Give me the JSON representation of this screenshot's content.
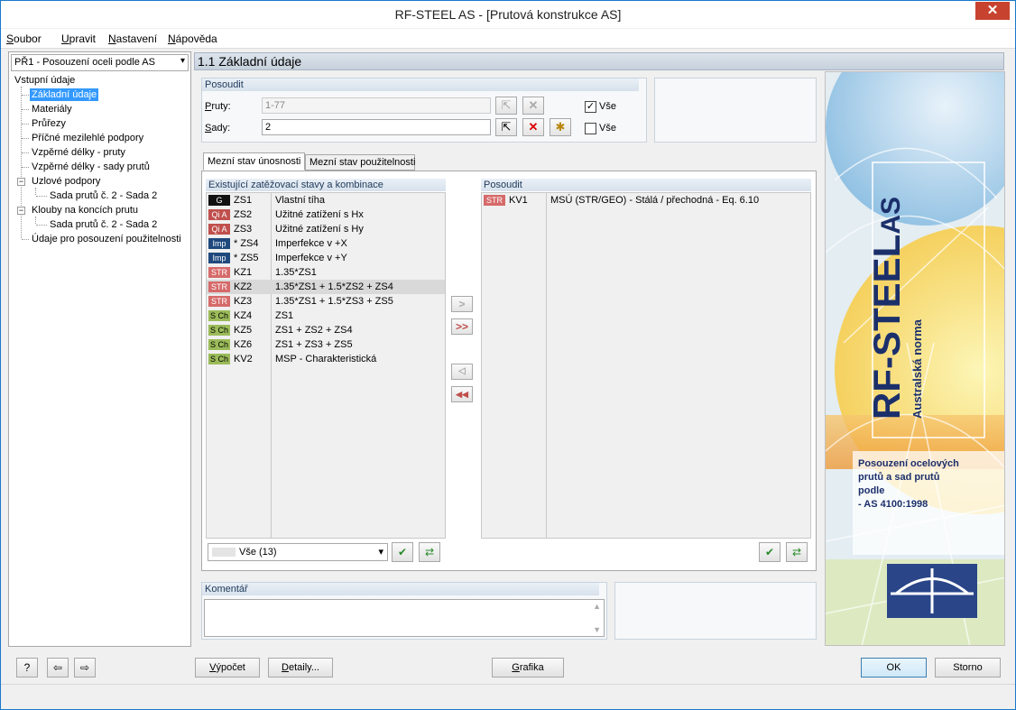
{
  "window": {
    "title": "RF-STEEL AS - [Prutová konstrukce AS]",
    "close_glyph": "✕"
  },
  "menu": [
    {
      "first": "S",
      "rest": "oubor"
    },
    {
      "first": "U",
      "rest": "pravit"
    },
    {
      "first": "N",
      "rest": "astavení"
    },
    {
      "first": "N",
      "rest": "ápověda"
    }
  ],
  "case_select": {
    "value": "PŘ1 - Posouzení oceli podle AS",
    "arrow": "▾"
  },
  "tree": {
    "root": "Vstupní údaje",
    "items": [
      "Základní údaje",
      "Materiály",
      "Průřezy",
      "Příčné mezilehlé podpory",
      "Vzpěrné délky - pruty",
      "Vzpěrné délky - sady prutů",
      "Uzlové podpory",
      "Sada prutů č. 2 - Sada 2",
      "Klouby na koncích prutu",
      "Sada prutů č. 2 - Sada 2",
      "Údaje pro posouzení použitelnosti"
    ],
    "expander_glyph": "−"
  },
  "header": {
    "title": "1.1 Základní údaje"
  },
  "posoudit": {
    "title": "Posoudit",
    "pruty_label_first": "P",
    "pruty_label_rest": "ruty:",
    "pruty_value": "1-77",
    "sady_label_first": "S",
    "sady_label_rest": "ady:",
    "sady_value": "2",
    "vse1_label": "Vše",
    "vse1_checked": "✓",
    "vse2_label": "Vše",
    "vse2_checked": ""
  },
  "tabs": [
    {
      "label": "Mezní stav únosnosti",
      "active": true
    },
    {
      "label": "Mezní stav použitelnosti",
      "active": false
    }
  ],
  "existing": {
    "title": "Existující zatěžovací stavy a kombinace",
    "rows": [
      {
        "badge": "G",
        "type": "G",
        "code": "ZS1",
        "desc": "Vlastní tíha"
      },
      {
        "badge": "Qi A",
        "type": "QiA",
        "code": "ZS2",
        "desc": "Užitné zatížení s Hx"
      },
      {
        "badge": "Qi A",
        "type": "QiA",
        "code": "ZS3",
        "desc": "Užitné zatížení s Hy"
      },
      {
        "badge": "Imp",
        "type": "Imp",
        "code": "* ZS4",
        "desc": "Imperfekce v +X"
      },
      {
        "badge": "Imp",
        "type": "Imp",
        "code": "* ZS5",
        "desc": "Imperfekce v +Y"
      },
      {
        "badge": "STR",
        "type": "STR",
        "code": "KZ1",
        "desc": "1.35*ZS1"
      },
      {
        "badge": "STR",
        "type": "STR",
        "code": "KZ2",
        "desc": "1.35*ZS1 + 1.5*ZS2 + ZS4"
      },
      {
        "badge": "STR",
        "type": "STR",
        "code": "KZ3",
        "desc": "1.35*ZS1 + 1.5*ZS3 + ZS5"
      },
      {
        "badge": "S Ch",
        "type": "SCh",
        "code": "KZ4",
        "desc": "ZS1"
      },
      {
        "badge": "S Ch",
        "type": "SCh",
        "code": "KZ5",
        "desc": "ZS1 + ZS2 + ZS4"
      },
      {
        "badge": "S Ch",
        "type": "SCh",
        "code": "KZ6",
        "desc": "ZS1 + ZS3 + ZS5"
      },
      {
        "badge": "S Ch",
        "type": "SCh",
        "code": "KV2",
        "desc": "MSP - Charakteristická"
      }
    ],
    "filter_value": "Vše (13)"
  },
  "selected": {
    "title": "Posoudit",
    "rows": [
      {
        "badge": "STR",
        "type": "STR",
        "code": "KV1",
        "desc": "MSÚ (STR/GEO) - Stálá / přechodná - Eq. 6.10"
      }
    ]
  },
  "transfer": {
    "add": ">",
    "add_all": ">>",
    "remove": "◁",
    "remove_all": "◀◀"
  },
  "comment": {
    "title": "Komentář"
  },
  "art": {
    "product": "RF-STEEL",
    "suffix": "AS",
    "subtitle": "Australská norma",
    "description": [
      "Posouzení ocelových",
      "prutů a sad prutů",
      "podle",
      "- AS 4100:1998"
    ]
  },
  "buttons": {
    "vypocet_first": "V",
    "vypocet_rest": "ýpočet",
    "detaily_first": "D",
    "detaily_rest": "etaily...",
    "grafika_first": "G",
    "grafika_rest": "rafika",
    "ok": "OK",
    "storno": "Storno"
  },
  "colors": {
    "selection": "#3399ff",
    "accent": "#1979ca",
    "close": "#c7432f"
  }
}
